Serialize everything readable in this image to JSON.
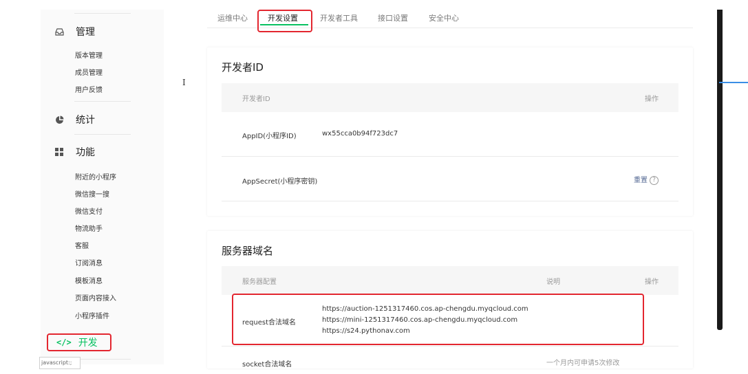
{
  "sidebar": {
    "sections": [
      {
        "title": "管理",
        "icon": "inbox-icon",
        "items": [
          "版本管理",
          "成员管理",
          "用户反馈"
        ]
      },
      {
        "title": "统计",
        "icon": "pie-chart-icon",
        "items": []
      },
      {
        "title": "功能",
        "icon": "grid-icon",
        "items": [
          "附近的小程序",
          "微信搜一搜",
          "微信支付",
          "物流助手",
          "客服",
          "订阅消息",
          "模板消息",
          "页面内容接入",
          "小程序插件"
        ]
      }
    ],
    "dev": {
      "icon_text": "</>",
      "label": "开发"
    },
    "tooltip": "javascript:;"
  },
  "tabs": [
    "运维中心",
    "开发设置",
    "开发者工具",
    "接口设置",
    "安全中心"
  ],
  "active_tab": "开发设置",
  "developer_card": {
    "title": "开发者ID",
    "header": {
      "col1": "开发者ID",
      "col_action": "操作"
    },
    "rows": [
      {
        "label": "AppID(小程序ID)",
        "value": "wx55cca0b94f723dc7"
      },
      {
        "label": "AppSecret(小程序密钥)",
        "action": "重置",
        "help": "?"
      }
    ]
  },
  "server_card": {
    "title": "服务器域名",
    "header": {
      "col1": "服务器配置",
      "col_desc": "说明",
      "col_action": "操作"
    },
    "request": {
      "label": "request合法域名",
      "domains": [
        "https://auction-1251317460.cos.ap-chengdu.myqcloud.com",
        "https://mini-1251317460.cos.ap-chengdu.myqcloud.com",
        "https://s24.pythonav.com"
      ]
    },
    "socket": {
      "label": "socket合法域名",
      "desc": "一个月内可申请5次修改"
    }
  },
  "colors": {
    "accent": "#07c160",
    "highlight": "#e3262f",
    "link": "#576b95"
  }
}
